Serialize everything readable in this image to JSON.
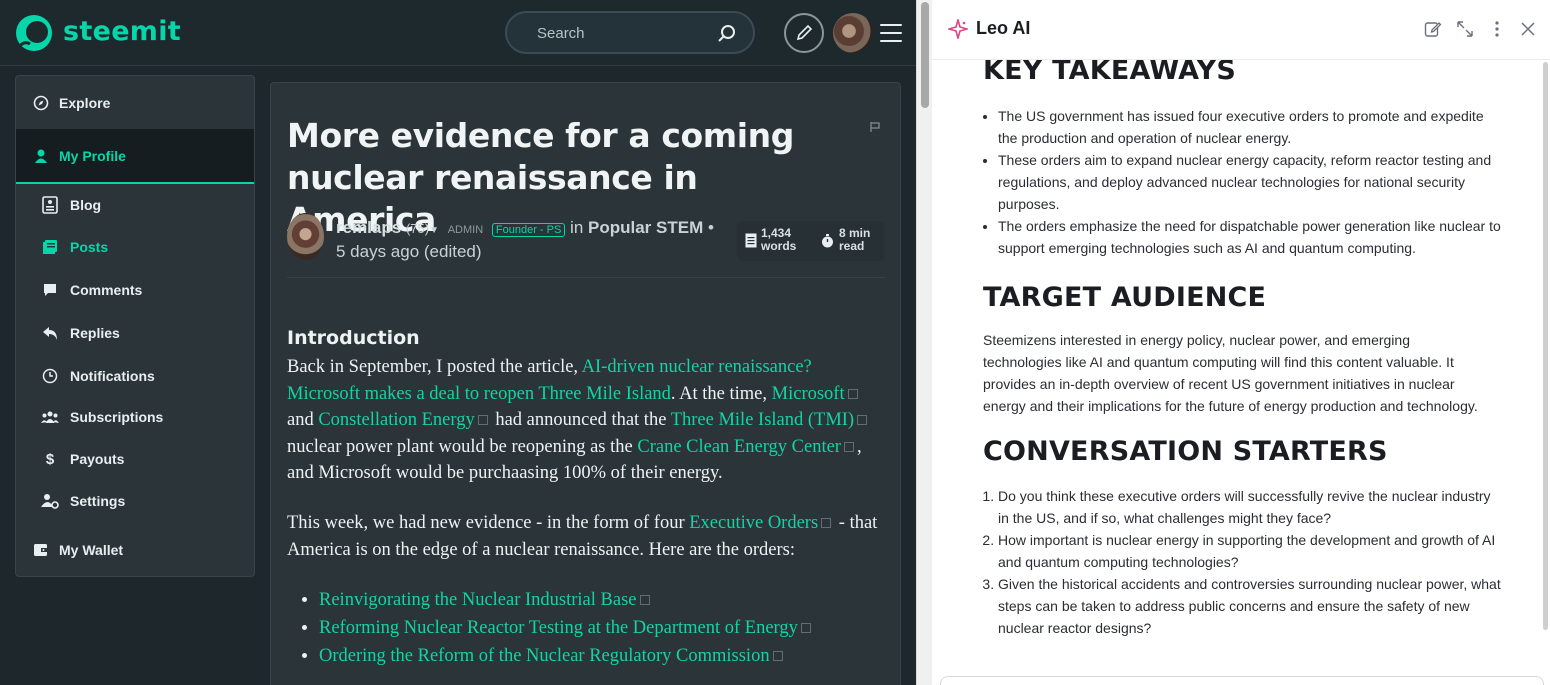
{
  "steemit": {
    "brand": "steemit",
    "search_placeholder": "Search",
    "nav": [
      {
        "label": "Explore",
        "icon": "compass-icon"
      },
      {
        "label": "My Profile",
        "icon": "person-icon"
      },
      {
        "label": "Blog",
        "icon": "blog-icon"
      },
      {
        "label": "Posts",
        "icon": "posts-icon"
      },
      {
        "label": "Comments",
        "icon": "comment-icon"
      },
      {
        "label": "Replies",
        "icon": "reply-icon"
      },
      {
        "label": "Notifications",
        "icon": "clock-icon"
      },
      {
        "label": "Subscriptions",
        "icon": "people-icon"
      },
      {
        "label": "Payouts",
        "icon": "dollar-icon"
      },
      {
        "label": "Settings",
        "icon": "user-gear-icon"
      },
      {
        "label": "My Wallet",
        "icon": "wallet-icon"
      }
    ],
    "post": {
      "title": "More evidence for a coming nuclear renaissance in America",
      "author": "remlaps",
      "reputation": "(75)",
      "role": "ADMIN",
      "badge": "Founder - PS",
      "in_word": "in",
      "community": "Popular STEM",
      "age": "• 5 days ago (edited)",
      "words_count": "1,434",
      "words_label": "words",
      "read_time": "8 min",
      "read_label": "read",
      "intro_heading": "Introduction",
      "p1": [
        "Back in September, I posted the article, ",
        "AI-driven nuclear renaissance? Microsoft makes a deal to reopen Three Mile Island",
        ". At the time, ",
        "Microsoft",
        " and ",
        "Constellation Energy",
        " had announced that the ",
        "Three Mile Island (TMI)",
        " nuclear power plant would be reopening as the ",
        "Crane Clean Energy Center",
        ", and Microsoft would be purchaasing 100% of their energy."
      ],
      "p2": [
        "This week, we had new evidence - in the form of four ",
        "Executive Orders",
        " - that America is on the edge of a nuclear renaissance. Here are the orders:"
      ],
      "orders": [
        "Reinvigorating the Nuclear Industrial Base",
        "Reforming Nuclear Reactor Testing at the Department of Energy",
        "Ordering the Reform of the Nuclear Regulatory Commission"
      ]
    }
  },
  "leo": {
    "title": "Leo AI",
    "key_takeaways_heading": "KEY TAKEAWAYS",
    "key_takeaways": [
      "The US government has issued four executive orders to promote and expedite the production and operation of nuclear energy.",
      "These orders aim to expand nuclear energy capacity, reform reactor testing and regulations, and deploy advanced nuclear technologies for national security purposes.",
      "The orders emphasize the need for dispatchable power generation like nuclear to support emerging technologies such as AI and quantum computing."
    ],
    "audience_heading": "TARGET AUDIENCE",
    "audience_text": "Steemizens interested in energy policy, nuclear power, and emerging technologies like AI and quantum computing will find this content valuable. It provides an in-depth overview of recent US government initiatives in nuclear energy and their implications for the future of energy production and technology.",
    "starters_heading": "CONVERSATION STARTERS",
    "starters": [
      "Do you think these executive orders will successfully revive the nuclear industry in the US, and if so, what challenges might they face?",
      "How important is nuclear energy in supporting the development and growth of AI and quantum computing technologies?",
      "Given the historical accidents and controversies surrounding nuclear power, what steps can be taken to address public concerns and ensure the safety of new nuclear reactor designs?"
    ]
  },
  "colors": {
    "accent": "#07d6aa",
    "link": "#15d3a5",
    "dark_bg": "#1e272b",
    "leo_star": "#e0437f"
  }
}
